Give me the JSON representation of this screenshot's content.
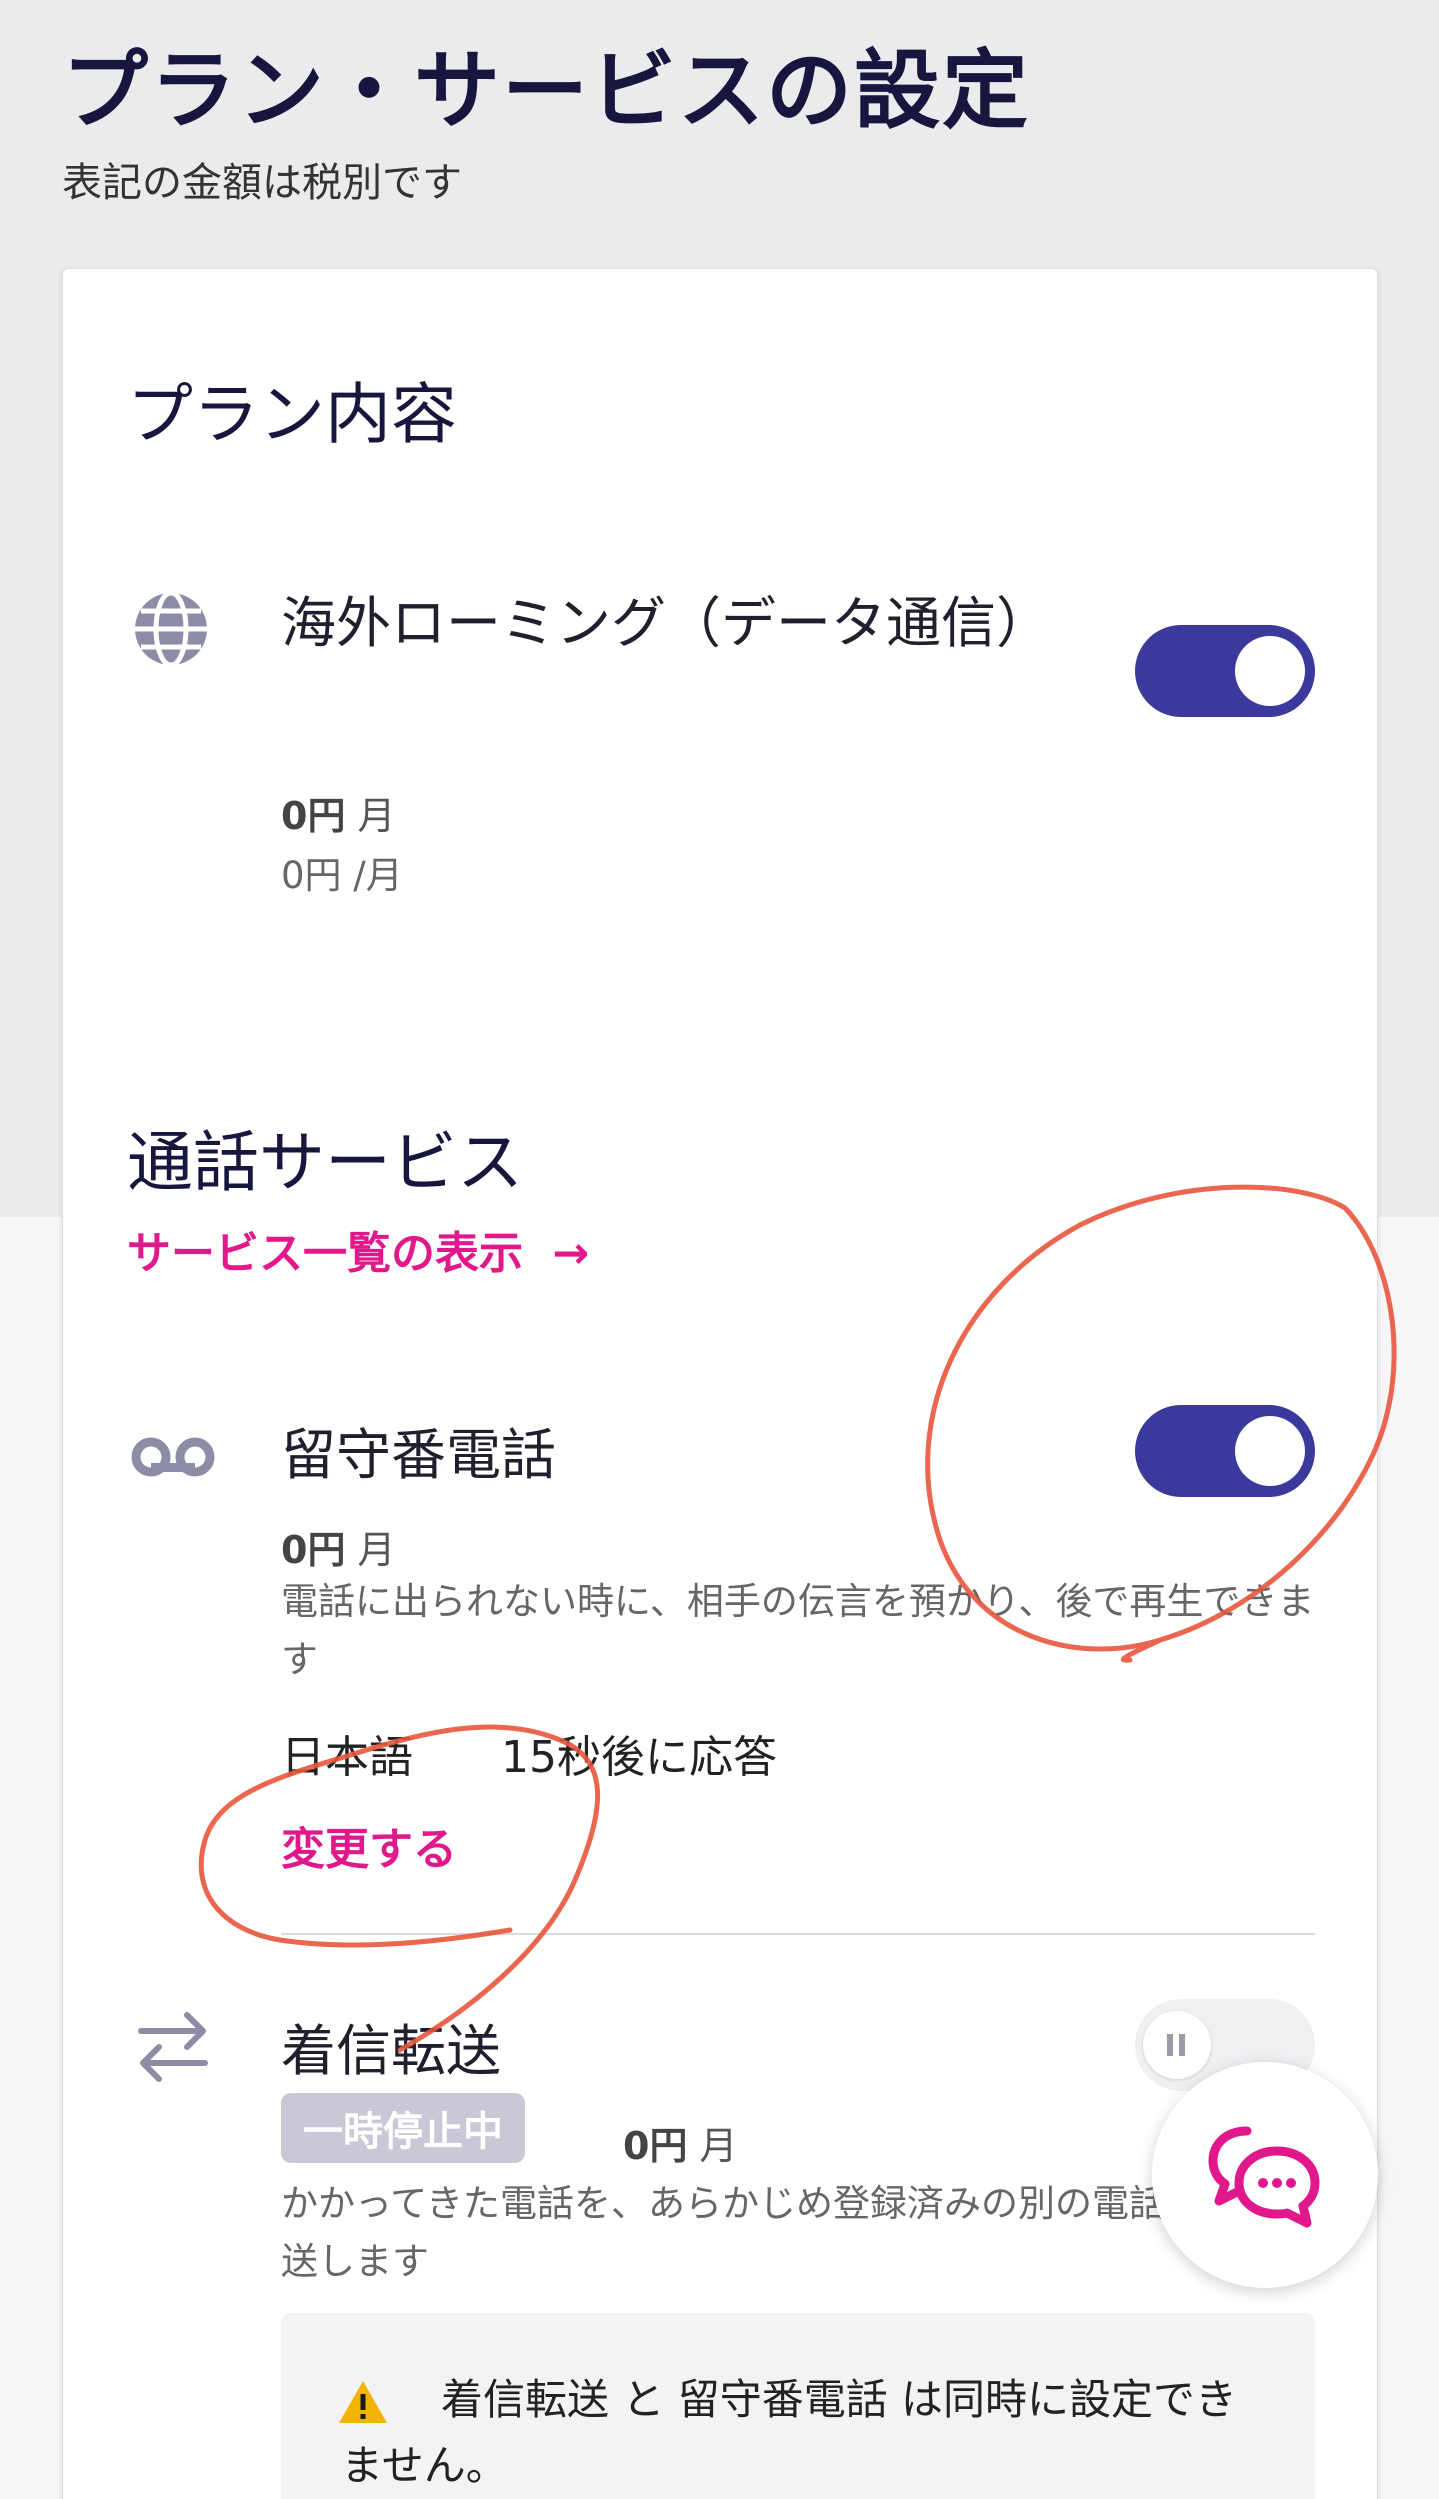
{
  "header": {
    "title": "プラン・サービスの設定",
    "subtitle": "表記の金額は税別です"
  },
  "plan_section": {
    "title": "プラン内容",
    "items": [
      {
        "icon": "globe-icon",
        "name": "海外ローミング（データ通信）",
        "price_amount": "0円",
        "price_unit": "月",
        "price_sub": "0円 /月",
        "enabled": true
      }
    ]
  },
  "call_section": {
    "title": "通話サービス",
    "link_label": "サービス一覧の表示",
    "link_arrow": "→",
    "voicemail": {
      "icon": "voicemail-icon",
      "name": "留守番電話",
      "price_amount": "0円",
      "price_unit": "月",
      "description": "電話に出られない時に、相手の伝言を預かり、後で再生できます",
      "setting_language": "日本語",
      "setting_timing": "15秒後に応答",
      "change_label": "変更する",
      "enabled": true
    },
    "forwarding": {
      "icon": "transfer-arrows-icon",
      "name": "着信転送",
      "status_badge": "一時停止中",
      "price_amount": "0円",
      "price_unit": "月",
      "description": "かかってきた電話を、あらかじめ登録済みの別の電話",
      "description_line2": "送します",
      "enabled": false,
      "paused": true
    },
    "notice": {
      "icon": "warning-icon",
      "text": "着信転送 と 留守番電話 は同時に設定できません。"
    }
  },
  "chat_button": {
    "icon": "chat-bubbles-icon"
  },
  "colors": {
    "accent_pink": "#e0188c",
    "toggle_on": "#3b3a9c",
    "title_navy": "#17163f",
    "annotation_red": "#e8553c"
  }
}
